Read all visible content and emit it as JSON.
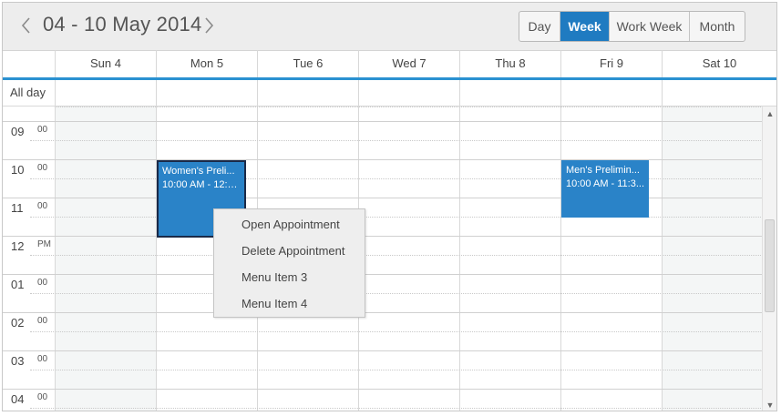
{
  "header": {
    "range": "04 - 10 May 2014",
    "prev_icon": "chevron-left-icon",
    "next_icon": "chevron-right-icon",
    "views": [
      {
        "label": "Day",
        "active": false
      },
      {
        "label": "Week",
        "active": true
      },
      {
        "label": "Work Week",
        "active": false
      },
      {
        "label": "Month",
        "active": false
      }
    ]
  },
  "days": [
    "Sun 4",
    "Mon 5",
    "Tue 6",
    "Wed 7",
    "Thu 8",
    "Fri 9",
    "Sat 10"
  ],
  "all_day_label": "All day",
  "time_slots": [
    {
      "hour": "09",
      "min": "00"
    },
    {
      "hour": "10",
      "min": "00"
    },
    {
      "hour": "11",
      "min": "00"
    },
    {
      "hour": "12",
      "min": "PM"
    },
    {
      "hour": "01",
      "min": "00"
    },
    {
      "hour": "02",
      "min": "00"
    },
    {
      "hour": "03",
      "min": "00"
    },
    {
      "hour": "04",
      "min": "00"
    }
  ],
  "appointments": [
    {
      "title": "Women's Preli...",
      "time": "10:00 AM - 12:0...",
      "day": "Mon 5",
      "selected": true
    },
    {
      "title": "Men's Prelimin...",
      "time": "10:00 AM - 11:3...",
      "day": "Fri 9",
      "selected": false
    }
  ],
  "context_menu": [
    "Open Appointment",
    "Delete Appointment",
    "Menu Item 3",
    "Menu Item 4"
  ],
  "colors": {
    "accent": "#1f7bc1",
    "appointment": "#2a83c8",
    "weekend": "#f4f6f6"
  }
}
